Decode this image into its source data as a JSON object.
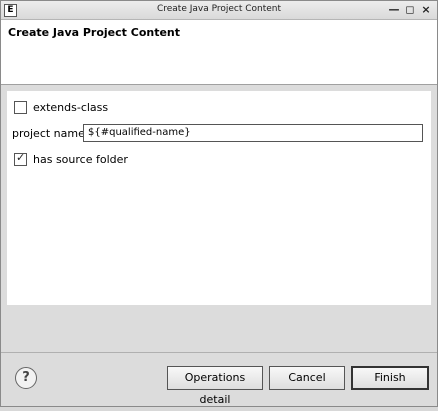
{
  "window": {
    "title": "Create Java Project Content",
    "app_icon_glyph": "E"
  },
  "header": {
    "title": "Create Java Project Content"
  },
  "form": {
    "extends_class": {
      "label": "extends-class",
      "checked": false
    },
    "project_name": {
      "label": "project name:",
      "value": "${#qualified-name}"
    },
    "has_source_folder": {
      "label": "has source folder",
      "checked": true
    }
  },
  "buttons": {
    "help": "?",
    "operations": "Operations detail",
    "cancel": "Cancel",
    "finish": "Finish"
  },
  "icons": {
    "app": "eclipse-app-icon",
    "help": "help-icon",
    "check": "checkmark-icon"
  }
}
